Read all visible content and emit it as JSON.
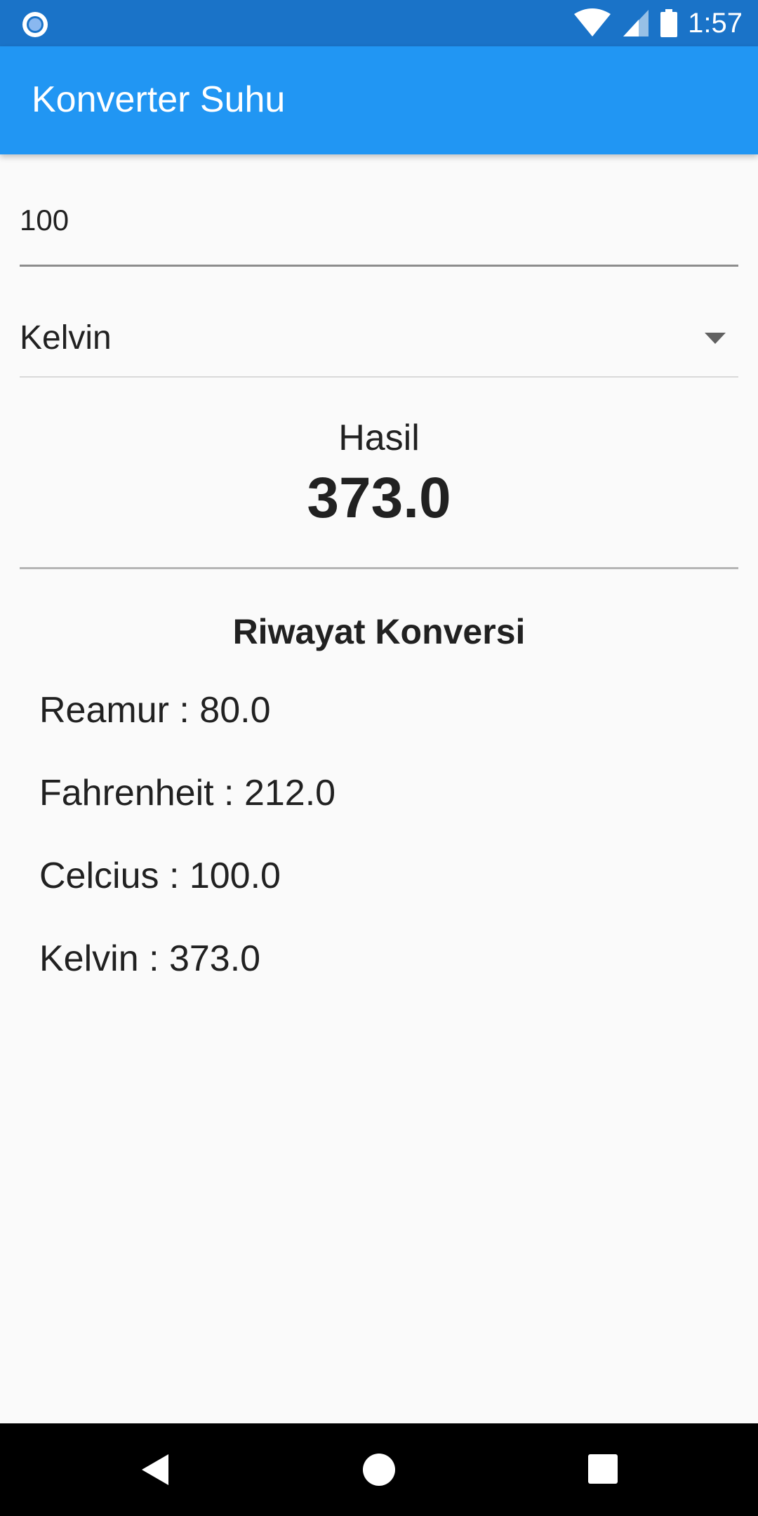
{
  "status_bar": {
    "time": "1:57",
    "icons": [
      "notification-dot-icon",
      "wifi-icon",
      "cell-signal-icon",
      "battery-icon"
    ]
  },
  "app_bar": {
    "title": "Konverter Suhu",
    "color": "#2196f3"
  },
  "input": {
    "value": "100"
  },
  "unit_select": {
    "selected": "Kelvin"
  },
  "result": {
    "label": "Hasil",
    "value": "373.0"
  },
  "history": {
    "title": "Riwayat Konversi",
    "items": [
      {
        "label": "Reamur : 80.0"
      },
      {
        "label": "Fahrenheit : 212.0"
      },
      {
        "label": "Celcius : 100.0"
      },
      {
        "label": "Kelvin : 373.0"
      }
    ]
  },
  "nav_bar": {
    "icons": [
      "back-icon",
      "home-icon",
      "recent-apps-icon"
    ]
  }
}
